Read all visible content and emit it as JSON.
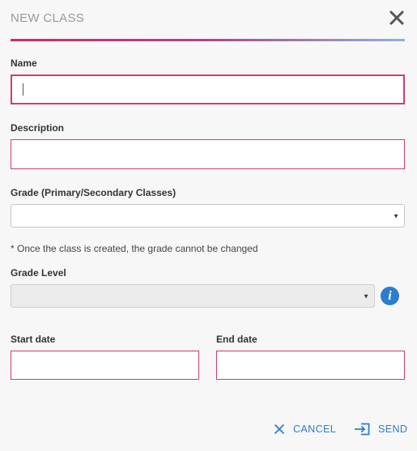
{
  "dialog": {
    "title": "NEW CLASS",
    "close_icon": "close-icon"
  },
  "form": {
    "name_label": "Name",
    "name_value": "",
    "description_label": "Description",
    "description_value": "",
    "grade_label": "Grade (Primary/Secondary Classes)",
    "grade_value": "",
    "grade_note": "* Once the class is created, the grade cannot be changed",
    "grade_level_label": "Grade Level",
    "grade_level_value": "",
    "grade_level_info_icon": "info-icon",
    "start_date_label": "Start date",
    "start_date_value": "",
    "end_date_label": "End date",
    "end_date_value": ""
  },
  "footer": {
    "cancel_label": "CANCEL",
    "cancel_icon": "close-icon",
    "send_label": "SEND",
    "send_icon": "send-icon"
  },
  "colors": {
    "accent_pink": "#d23a6e",
    "accent_blue": "#2d7dcf",
    "title_gray": "#9a9a9a"
  }
}
